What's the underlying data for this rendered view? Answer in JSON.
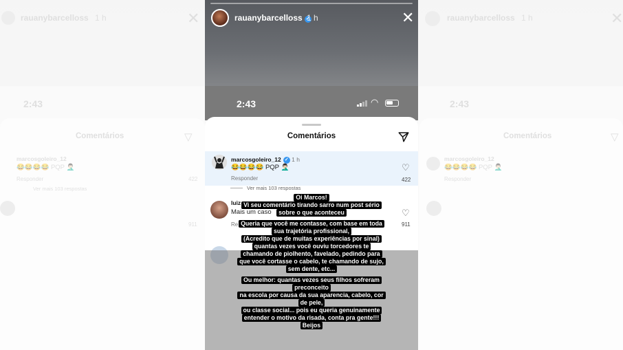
{
  "story": {
    "username": "rauanybarcelloss",
    "time_ago": "1 h",
    "close_icon": "close-icon"
  },
  "status_bar": {
    "clock": "2:43"
  },
  "comments_sheet": {
    "title": "Comentários",
    "comments": [
      {
        "username": "marcosgoleiro_12",
        "time": "1 h",
        "text": "😂😂😂😂 PQP 🤦🏻‍♂️",
        "reply_label": "Responder",
        "likes": "422",
        "view_more": "Ver mais 103 respostas"
      },
      {
        "username": "luiz",
        "text": "Mais um caso",
        "reply_label": "Re",
        "likes": "911"
      }
    ]
  },
  "caption": [
    [
      "Oi Marcos!",
      "Vi seu comentário tirando sarro num post sério",
      "sobre o que aconteceu"
    ],
    [
      "Queria que você me contasse, com base em toda",
      "sua trajetória profissional,",
      "(Acredito que de muitas experiências por sinal)",
      "quantas vezes você ouviu torcedores te",
      "chamando de piolhento, favelado, pedindo para",
      "que você cortasse o cabelo, te chamando de sujo,",
      "sem dente, etc..."
    ],
    [
      "Ou melhor: quantas vezes seus filhos sofreram",
      "preconceito",
      "na escola por causa da sua aparencia, cabelo, cor",
      "de pele,",
      "ou classe social... pois eu queria genuinamente",
      "entender o motivo da risada, conta pra gente!!!",
      "Beijos"
    ]
  ],
  "colors": {
    "verified": "#3897f0",
    "highlight": "#eaf3fc"
  }
}
